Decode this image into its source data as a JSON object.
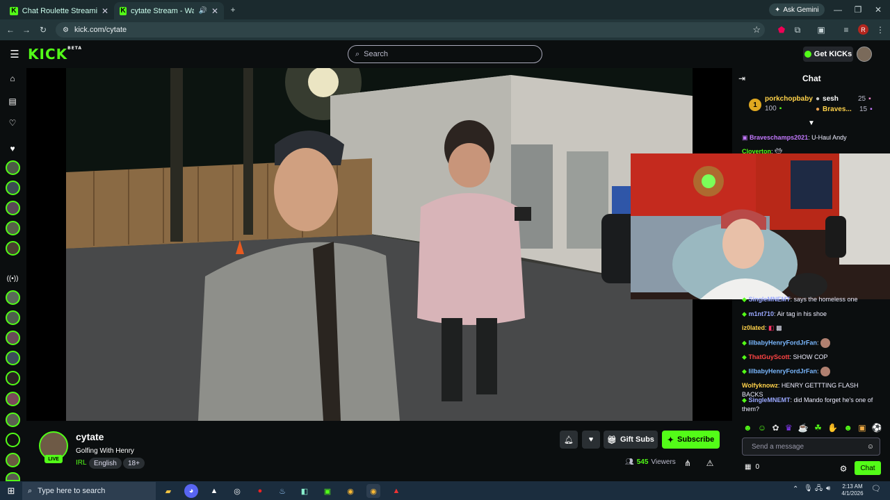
{
  "browser": {
    "tabs": [
      {
        "title": "Chat Roulette Streaming - Live",
        "active": false
      },
      {
        "title": "cytate Stream - Watch Live",
        "active": true
      }
    ],
    "url": "kick.com/cytate",
    "ask_gemini": "Ask Gemini",
    "profile_letter": "R"
  },
  "kick": {
    "logo": "KICK",
    "logo_badge": "BETA",
    "search_placeholder": "Search",
    "get_kicks": "Get KICKs"
  },
  "channel": {
    "name": "cytate",
    "live_label": "LIVE",
    "stream_title": "Golfing With Henry",
    "category": "IRL",
    "tags": [
      "English",
      "18+"
    ],
    "gift_subs": "Gift Subs",
    "subscribe": "Subscribe",
    "viewer_count": "545",
    "viewers_label": "Viewers"
  },
  "chat": {
    "title": "Chat",
    "top_gifters": [
      {
        "rank": "1",
        "name": "porkchopbaby",
        "count": "100"
      },
      {
        "name": "sesh",
        "count": "25"
      },
      {
        "name": "Braves...",
        "count": "15"
      }
    ],
    "messages_top": [
      {
        "user": "Braveschamps2021",
        "text": "U-Haul Andy",
        "color": "#c479ff"
      },
      {
        "user": "Cloverton",
        "text": "",
        "color": "#53fc18"
      }
    ],
    "messages": [
      {
        "user": "SingleMNEMT",
        "text": "says the homeless one",
        "color": "#9aa8ff"
      },
      {
        "user": "m1nt710",
        "text": "Air tag in his shoe",
        "color": "#9aa8ff"
      },
      {
        "user": "iz0lated",
        "text": "",
        "color": "#ffd24a"
      },
      {
        "user": "lilbabyHenryFordJrFan",
        "text": "",
        "color": "#7ab8ff"
      },
      {
        "user": "ThatGuyScott",
        "text": "SHOW COP",
        "color": "#ff4444"
      },
      {
        "user": "lilbabyHenryFordJrFan",
        "text": "",
        "color": "#7ab8ff"
      },
      {
        "user": "Wolfyknowz",
        "text": "HENRY GETTTING FLASH BACKS",
        "color": "#ffd24a"
      },
      {
        "user": "SingleMNEMT",
        "text": "did Mando forget he's one of them?",
        "color": "#9aa8ff"
      }
    ],
    "send_placeholder": "Send a message",
    "points": "0",
    "chat_button": "Chat"
  },
  "taskbar": {
    "search_placeholder": "Type here to search",
    "time": "2:13 AM",
    "date": "4/1/2026"
  }
}
